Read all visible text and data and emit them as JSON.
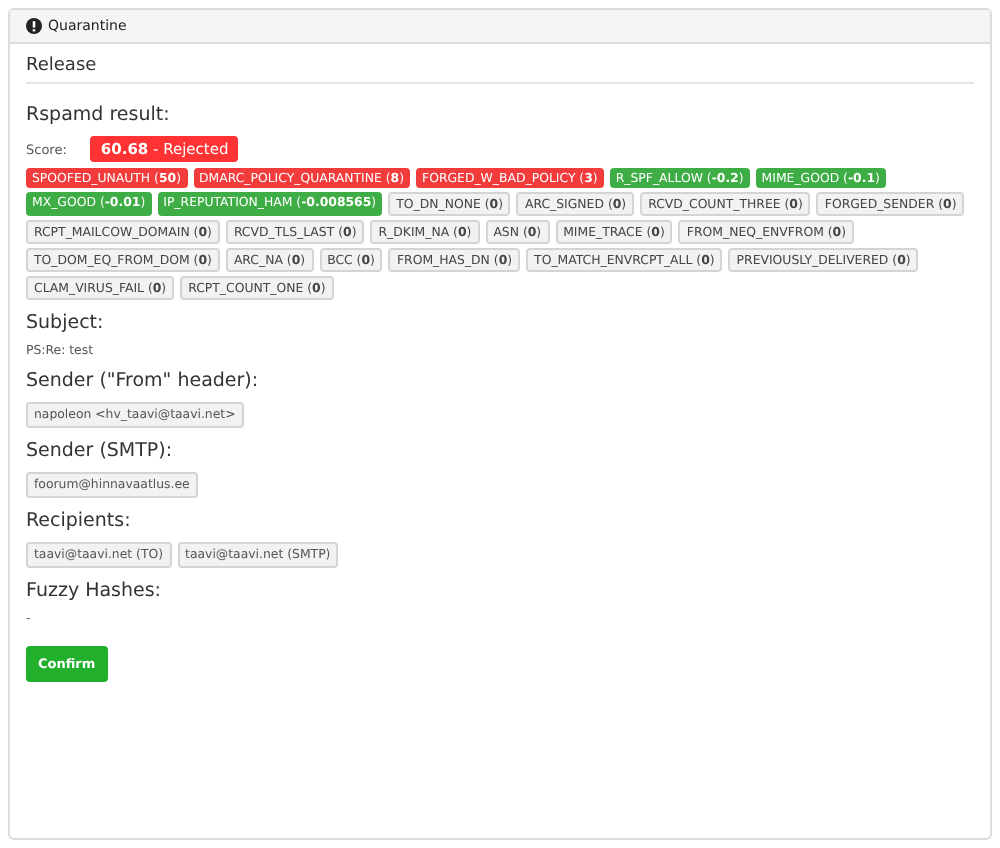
{
  "panel": {
    "title": "Quarantine"
  },
  "section_title": "Release",
  "rspamd": {
    "heading": "Rspamd result:",
    "score_label": "Score:",
    "score": "**60.68** - Rejected",
    "symbols": [
      {
        "label": "SPOOFED_UNAUTH (**50**)",
        "kind": "bad"
      },
      {
        "label": "DMARC_POLICY_QUARANTINE (**8**)",
        "kind": "bad"
      },
      {
        "label": "FORGED_W_BAD_POLICY (**3**)",
        "kind": "bad"
      },
      {
        "label": "R_SPF_ALLOW (**-0.2**)",
        "kind": "good"
      },
      {
        "label": "MIME_GOOD (**-0.1**)",
        "kind": "good"
      },
      {
        "label": "MX_GOOD (**-0.01**)",
        "kind": "good"
      },
      {
        "label": "IP_REPUTATION_HAM (**-0.008565**)",
        "kind": "good"
      },
      {
        "label": "TO_DN_NONE (**0**)",
        "kind": "neutral"
      },
      {
        "label": "ARC_SIGNED (**0**)",
        "kind": "neutral"
      },
      {
        "label": "RCVD_COUNT_THREE (**0**)",
        "kind": "neutral"
      },
      {
        "label": "FORGED_SENDER (**0**)",
        "kind": "neutral"
      },
      {
        "label": "RCPT_MAILCOW_DOMAIN (**0**)",
        "kind": "neutral"
      },
      {
        "label": "RCVD_TLS_LAST (**0**)",
        "kind": "neutral"
      },
      {
        "label": "R_DKIM_NA (**0**)",
        "kind": "neutral"
      },
      {
        "label": "ASN (**0**)",
        "kind": "neutral"
      },
      {
        "label": "MIME_TRACE (**0**)",
        "kind": "neutral"
      },
      {
        "label": "FROM_NEQ_ENVFROM (**0**)",
        "kind": "neutral"
      },
      {
        "label": "TO_DOM_EQ_FROM_DOM (**0**)",
        "kind": "neutral"
      },
      {
        "label": "ARC_NA (**0**)",
        "kind": "neutral"
      },
      {
        "label": "BCC (**0**)",
        "kind": "neutral"
      },
      {
        "label": "FROM_HAS_DN (**0**)",
        "kind": "neutral"
      },
      {
        "label": "TO_MATCH_ENVRCPT_ALL (**0**)",
        "kind": "neutral"
      },
      {
        "label": "PREVIOUSLY_DELIVERED (**0**)",
        "kind": "neutral"
      },
      {
        "label": "CLAM_VIRUS_FAIL (**0**)",
        "kind": "neutral"
      },
      {
        "label": "RCPT_COUNT_ONE (**0**)",
        "kind": "neutral"
      }
    ]
  },
  "fields": [
    {
      "heading": "Subject:",
      "kind": "text",
      "values": [
        "PS:Re: test"
      ]
    },
    {
      "heading": "Sender (\"From\" header):",
      "kind": "tags",
      "values": [
        "napoleon <hv_taavi@taavi.net>"
      ]
    },
    {
      "heading": "Sender (SMTP):",
      "kind": "tags",
      "values": [
        "foorum@hinnavaatlus.ee"
      ]
    },
    {
      "heading": "Recipients:",
      "kind": "tags",
      "values": [
        "taavi@taavi.net (TO)",
        "taavi@taavi.net (SMTP)"
      ]
    },
    {
      "heading": "Fuzzy Hashes:",
      "kind": "text",
      "values": [
        "-"
      ]
    }
  ],
  "confirm_button": "Confirm"
}
